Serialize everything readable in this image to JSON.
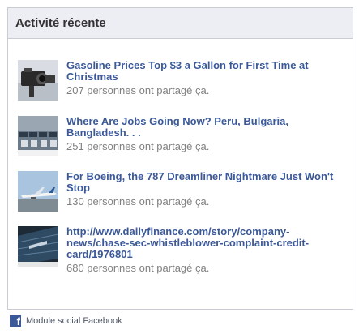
{
  "header": {
    "title": "Activité récente"
  },
  "items": [
    {
      "headline": "Gasoline Prices Top $3 a Gallon for First Time at Christmas",
      "shares": "207 personnes ont partagé ça.",
      "thumb_icon": "news-thumbnail-camera-icon"
    },
    {
      "headline": "Where Are Jobs Going Now? Peru, Bulgaria, Bangladesh. . .",
      "shares": "251 personnes ont partagé ça.",
      "thumb_icon": "news-thumbnail-factory-icon"
    },
    {
      "headline": "For Boeing, the 787 Dreamliner Nightmare Just Won't Stop",
      "shares": "130 personnes ont partagé ça.",
      "thumb_icon": "news-thumbnail-airplane-icon"
    },
    {
      "headline": "http://www.dailyfinance.com/story/company-news/chase-sec-whistleblower-complaint-credit-card/1976801",
      "shares": "680 personnes ont partagé ça.",
      "thumb_icon": "news-thumbnail-building-icon"
    }
  ],
  "footer": {
    "label": "Module social Facebook",
    "icon": "facebook-icon"
  },
  "colors": {
    "link": "#3b5998",
    "muted": "#808080",
    "header_bg": "#eceef4",
    "border": "#c9ccd2"
  }
}
